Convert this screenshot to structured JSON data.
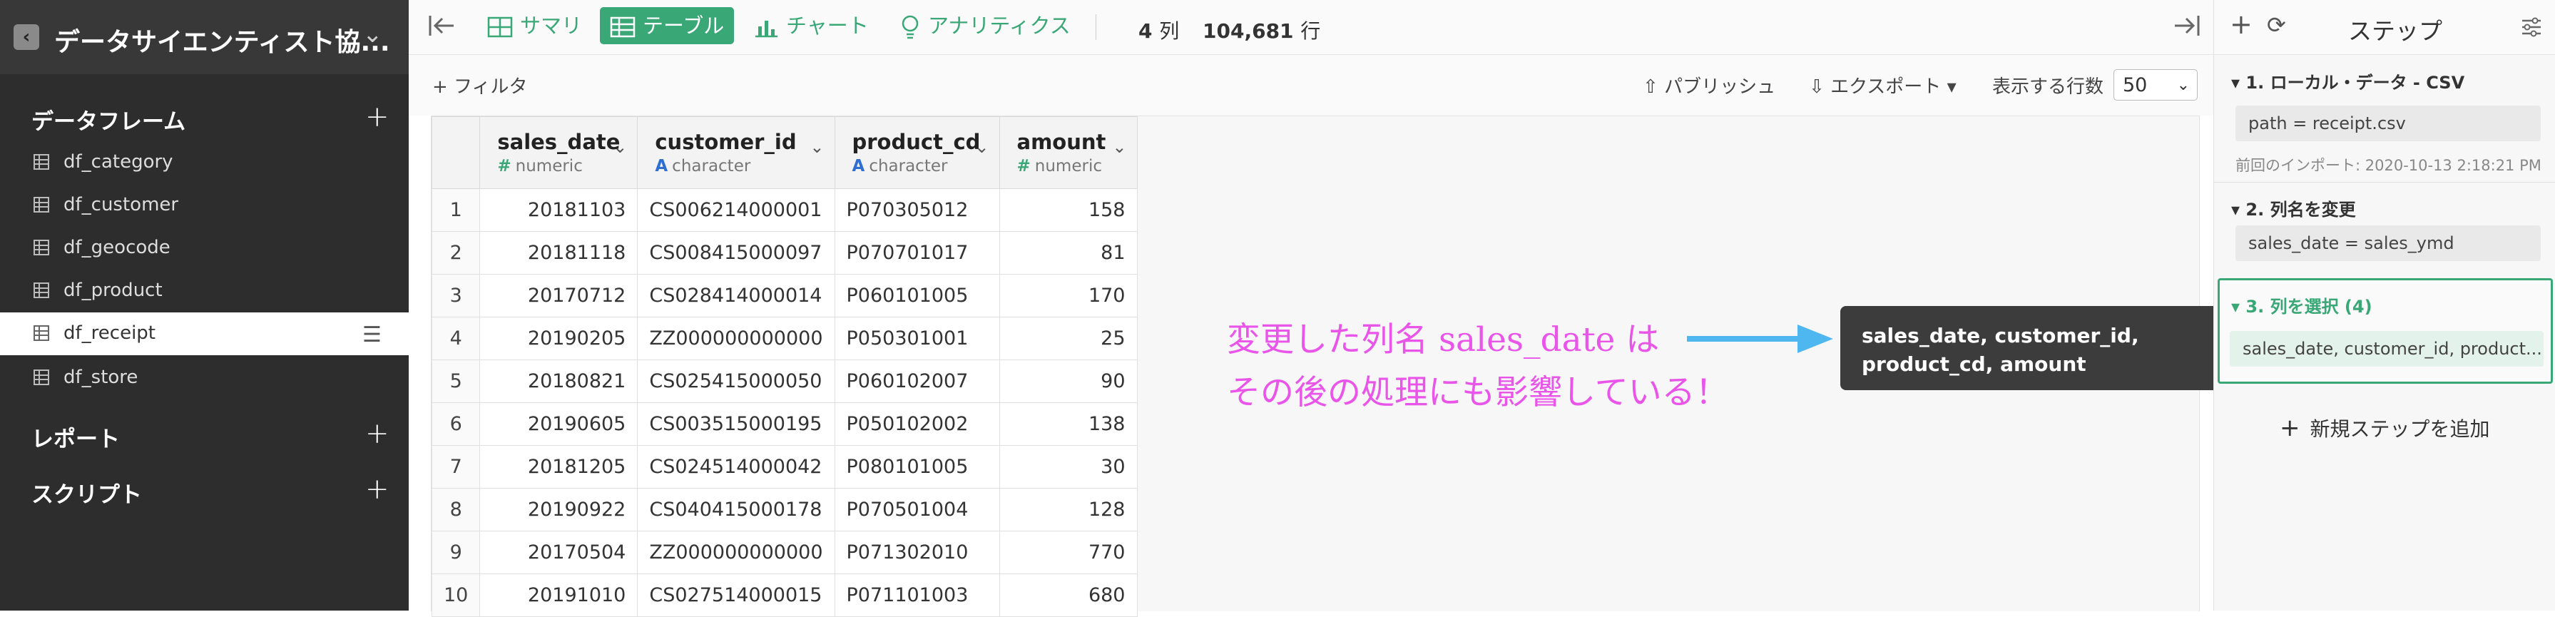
{
  "project": {
    "title": "データサイエンティスト協..."
  },
  "sidebar": {
    "sections": {
      "dataframes": "データフレーム",
      "reports": "レポート",
      "scripts": "スクリプト"
    },
    "dataframes": [
      {
        "label": "df_category"
      },
      {
        "label": "df_customer"
      },
      {
        "label": "df_geocode"
      },
      {
        "label": "df_product"
      },
      {
        "label": "df_receipt"
      },
      {
        "label": "df_store"
      }
    ]
  },
  "toolbar": {
    "summary": "サマリ",
    "table": "テーブル",
    "chart": "チャート",
    "analytics": "アナリティクス",
    "cols": "4",
    "cols_unit": "列",
    "rows": "104,681",
    "rows_unit": "行"
  },
  "filterbar": {
    "add_filter": "+ フィルタ",
    "publish": "パブリッシュ",
    "export": "エクスポート",
    "rows_label": "表示する行数",
    "rows_value": "50"
  },
  "table": {
    "columns": [
      {
        "name": "sales_date",
        "type_icon": "#",
        "type": "numeric"
      },
      {
        "name": "customer_id",
        "type_icon": "A",
        "type": "character"
      },
      {
        "name": "product_cd",
        "type_icon": "A",
        "type": "character"
      },
      {
        "name": "amount",
        "type_icon": "#",
        "type": "numeric"
      }
    ],
    "rows": [
      [
        "1",
        "20181103",
        "CS006214000001",
        "P070305012",
        "158"
      ],
      [
        "2",
        "20181118",
        "CS008415000097",
        "P070701017",
        "81"
      ],
      [
        "3",
        "20170712",
        "CS028414000014",
        "P060101005",
        "170"
      ],
      [
        "4",
        "20190205",
        "ZZ000000000000",
        "P050301001",
        "25"
      ],
      [
        "5",
        "20180821",
        "CS025415000050",
        "P060102007",
        "90"
      ],
      [
        "6",
        "20190605",
        "CS003515000195",
        "P050102002",
        "138"
      ],
      [
        "7",
        "20181205",
        "CS024514000042",
        "P080101005",
        "30"
      ],
      [
        "8",
        "20190922",
        "CS040415000178",
        "P070501004",
        "128"
      ],
      [
        "9",
        "20170504",
        "ZZ000000000000",
        "P071302010",
        "770"
      ],
      [
        "10",
        "20191010",
        "CS027514000015",
        "P071101003",
        "680"
      ]
    ]
  },
  "annotation": {
    "line1": "変更した列名 sales_date は",
    "line2": "その後の処理にも影響している！",
    "color": "#e855e8"
  },
  "tooltip": {
    "line1": "sales_date, customer_id,",
    "line2": "product_cd, amount"
  },
  "steps": {
    "title": "ステップ",
    "items": [
      {
        "title": "1. ローカル・データ - CSV",
        "value": "path = receipt.csv",
        "note": "前回のインポート: 2020-10-13 2:18:21 PM"
      },
      {
        "title": "2. 列名を変更",
        "value": "sales_date = sales_ymd"
      },
      {
        "title": "3. 列を選択 (4)",
        "value": "sales_date, customer_id, product..."
      }
    ],
    "add_step": "新規ステップを追加"
  },
  "colors": {
    "accent": "#3aa776",
    "sidebar": "#2d2d2d"
  }
}
